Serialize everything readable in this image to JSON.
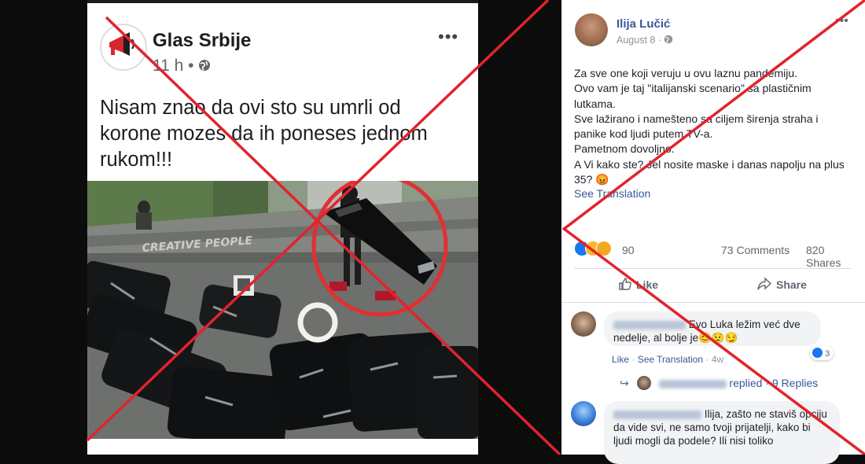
{
  "left_post": {
    "page_name": "Glas Srbije",
    "time": "11 h",
    "separator": "•",
    "text": "Nisam znao da ovi sto su umrli od korone mozes da ih poneses jednom rukom!!!",
    "watermark": "CREATIVE PEOPLE",
    "more_icon": "more-dots-icon",
    "privacy_icon": "globe-icon",
    "avatar_icon": "megaphone-icon"
  },
  "right_post": {
    "author": "Ilija Lučić",
    "date": "August 8 ·",
    "privacy_icon": "globe-icon",
    "more_icon": "more-dots-icon",
    "text_lines": [
      "Za sve one koji veruju u ovu laznu pandemiju.",
      "Ovo vam je taj \"italijanski scenario\" sa plastičnim lutkama.",
      "Sve lažirano i namešteno sa ciljem širenja straha i panike kod ljudi putem TV-a.",
      "Pametnom dovoljno.",
      "A Vi kako ste? Jel nosite maske i danas napolju na plus 35? 😡"
    ],
    "see_translation": "See Translation",
    "reactions_count": "90",
    "comments_count": "73 Comments",
    "shares_count": "820 Shares",
    "like_label": "Like",
    "share_label": "Share",
    "comment1": {
      "text": "Evo Luka ležim već dve nedelje, al bolje je😊😟😏",
      "like_link": "Like",
      "see_translation": "See Translation",
      "time": "4w",
      "like_count": "3"
    },
    "replies": {
      "text": "replied · 9 Replies"
    },
    "comment2": {
      "text": "Ilija, zašto ne staviš opciju da vide svi, ne samo tvoji prijatelji, kako bi ljudi mogli da podele? Ili nisi toliko"
    }
  },
  "overlay": {
    "cross_color": "#e0242c",
    "ring_color": "#e23030"
  }
}
